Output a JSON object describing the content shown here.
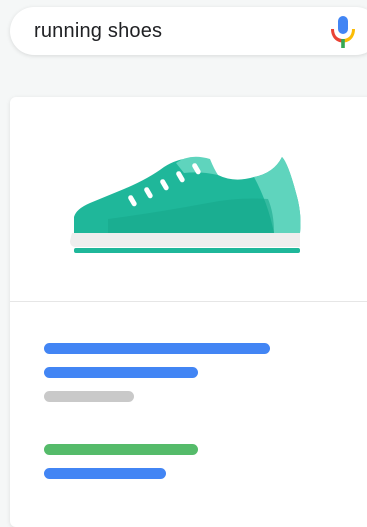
{
  "search": {
    "query": "running shoes",
    "mic_icon": "microphone-icon"
  },
  "result_card": {
    "image_icon": "running-shoe-icon",
    "text_placeholder_lines": [
      {
        "color": "#4285f4"
      },
      {
        "color": "#4285f4"
      },
      {
        "color": "#c9c9c9"
      },
      {
        "color": "#55bb6a"
      },
      {
        "color": "#4285f4"
      }
    ]
  },
  "colors": {
    "shoe_teal": "#1fb79a",
    "shoe_teal_light": "#5fd4bd",
    "google_blue": "#4285f4",
    "google_red": "#ea4335",
    "google_yellow": "#fbbc05",
    "google_green": "#34a853"
  }
}
